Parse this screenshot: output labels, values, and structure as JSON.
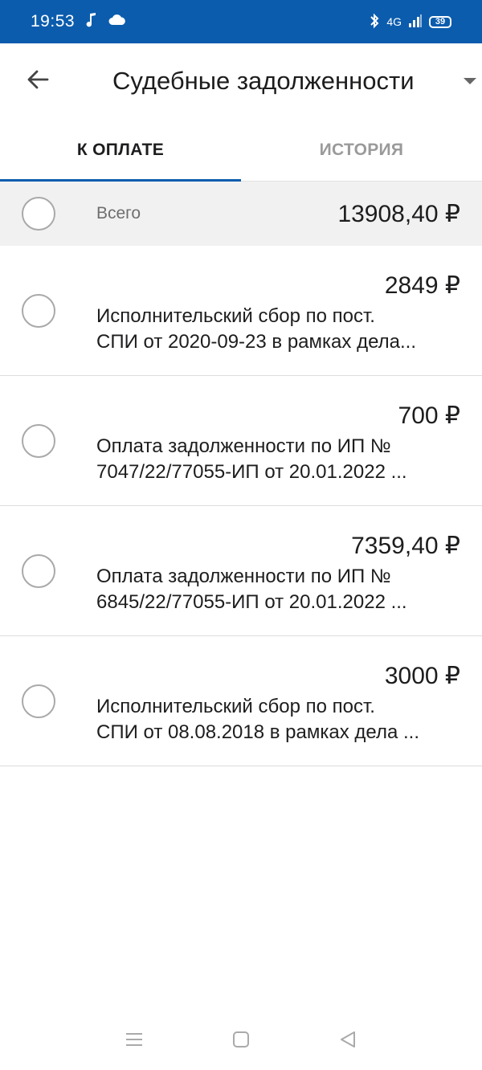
{
  "status_bar": {
    "time": "19:53",
    "network": "4G",
    "battery": "39",
    "icons": [
      "music-note-icon",
      "cloud-icon",
      "bluetooth-icon",
      "signal-icon",
      "battery-icon"
    ]
  },
  "app_bar": {
    "title": "Судебные задолженности",
    "back_icon": "arrow-left-icon",
    "caret_icon": "triangle-down-icon"
  },
  "tabs": [
    {
      "label": "К ОПЛАТЕ",
      "active": true
    },
    {
      "label": "ИСТОРИЯ",
      "active": false
    }
  ],
  "total": {
    "label": "Всего",
    "amount": "13908,40 ₽"
  },
  "debts": [
    {
      "amount": "2849 ₽",
      "line1": "Исполнительский сбор по пост.",
      "line2": "СПИ от 2020-09-23 в рамках дела..."
    },
    {
      "amount": "700 ₽",
      "line1": "Оплата задолженности по ИП №",
      "line2": "7047/22/77055-ИП от 20.01.2022 ..."
    },
    {
      "amount": "7359,40 ₽",
      "line1": "Оплата задолженности по ИП №",
      "line2": "6845/22/77055-ИП от 20.01.2022 ..."
    },
    {
      "amount": "3000 ₽",
      "line1": "Исполнительский сбор по пост.",
      "line2": "СПИ от 08.08.2018 в рамках дела ..."
    }
  ],
  "colors": {
    "accent": "#0b5cad",
    "total_row_bg": "#f1f1f1",
    "inactive_tab": "#9a9a9a"
  },
  "nav_bar": {
    "icons": [
      "menu-icon",
      "home-square-icon",
      "back-triangle-icon"
    ]
  }
}
